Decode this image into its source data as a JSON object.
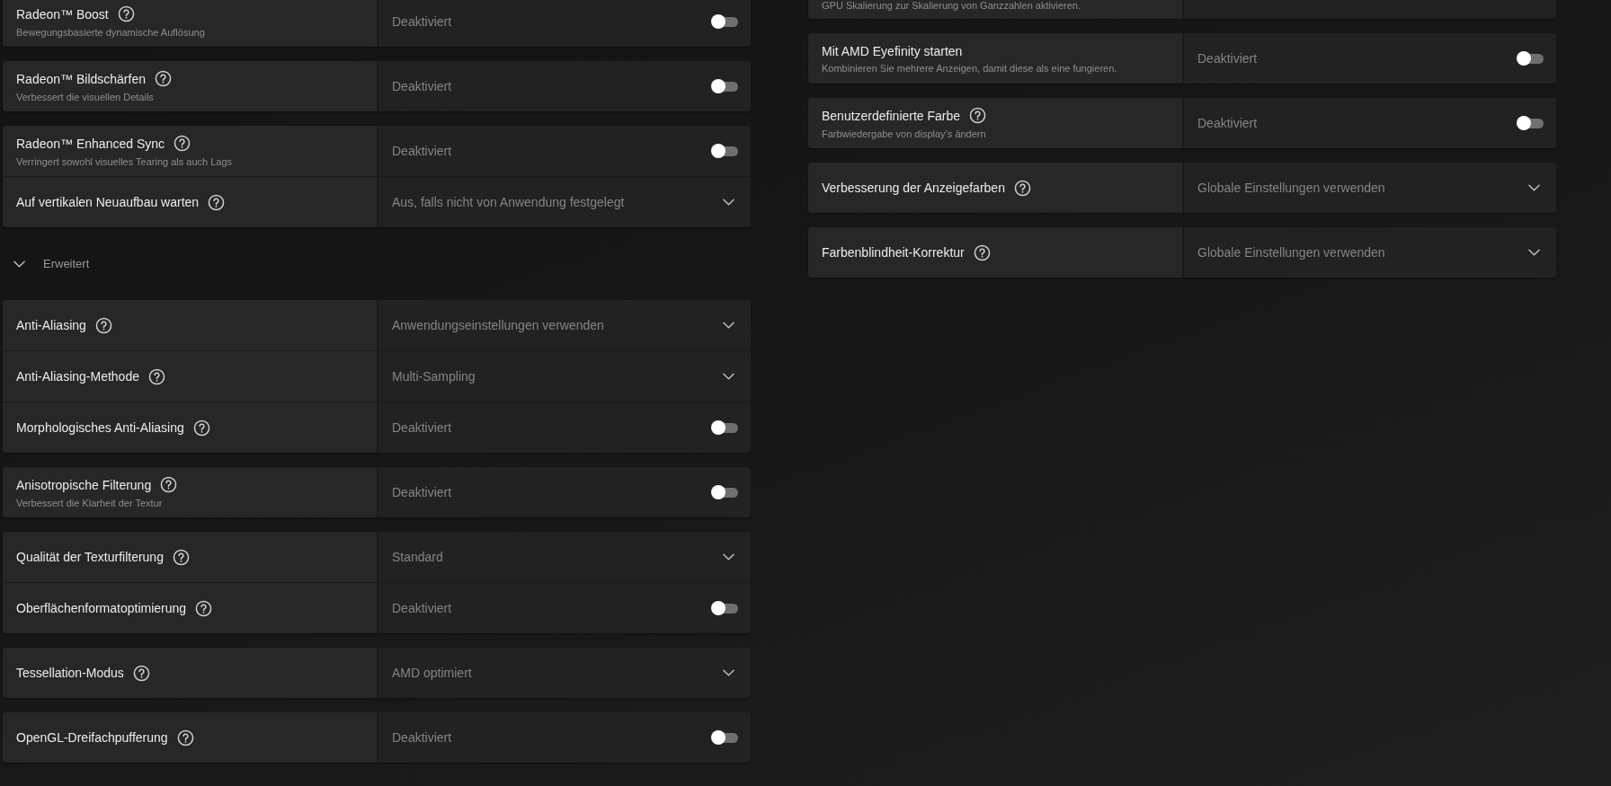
{
  "left_column": {
    "groups": [
      {
        "rows": [
          {
            "title": "Radeon™ Boost",
            "help": true,
            "description": "Bewegungsbasierte dynamische Auflösung",
            "value": "Deaktiviert",
            "kind": "toggle",
            "on": false
          }
        ]
      },
      {
        "rows": [
          {
            "title": "Radeon™ Bildschärfen",
            "help": true,
            "description": "Verbessert die visuellen Details",
            "value": "Deaktiviert",
            "kind": "toggle",
            "on": false
          }
        ]
      },
      {
        "rows": [
          {
            "title": "Radeon™ Enhanced Sync",
            "help": true,
            "description": "Verringert sowohl visuelles Tearing als auch Lags",
            "value": "Deaktiviert",
            "kind": "toggle",
            "on": false
          },
          {
            "title": "Auf vertikalen Neuaufbau warten",
            "help": true,
            "value": "Aus, falls nicht von Anwendung festgelegt",
            "kind": "dropdown"
          }
        ]
      }
    ],
    "advanced": {
      "label": "Erweitert",
      "expanded": true,
      "groups": [
        {
          "rows": [
            {
              "title": "Anti-Aliasing",
              "help": true,
              "value": "Anwendungseinstellungen verwenden",
              "kind": "dropdown"
            },
            {
              "title": "Anti-Aliasing-Methode",
              "help": true,
              "value": "Multi-Sampling",
              "kind": "dropdown"
            },
            {
              "title": "Morphologisches Anti-Aliasing",
              "help": true,
              "value": "Deaktiviert",
              "kind": "toggle",
              "on": false
            }
          ]
        },
        {
          "rows": [
            {
              "title": "Anisotropische Filterung",
              "help": true,
              "description": "Verbessert die Klarheit der Textur",
              "value": "Deaktiviert",
              "kind": "toggle",
              "on": false
            }
          ]
        },
        {
          "rows": [
            {
              "title": "Qualität der Texturfilterung",
              "help": true,
              "value": "Standard",
              "kind": "dropdown"
            },
            {
              "title": "Oberflächenformatoptimierung",
              "help": true,
              "value": "Deaktiviert",
              "kind": "toggle",
              "on": false
            }
          ]
        },
        {
          "rows": [
            {
              "title": "Tessellation-Modus",
              "help": true,
              "value": "AMD optimiert",
              "kind": "dropdown"
            }
          ]
        },
        {
          "rows": [
            {
              "title": "OpenGL-Dreifachpufferung",
              "help": true,
              "value": "Deaktiviert",
              "kind": "toggle",
              "on": false
            }
          ]
        }
      ]
    }
  },
  "right_column": {
    "groups": [
      {
        "rows": [
          {
            "description": "GPU Skalierung zur Skalierung von Ganzzahlen aktivieren.",
            "help": false,
            "kind": "none"
          }
        ]
      },
      {
        "rows": [
          {
            "title": "Mit AMD Eyefinity starten",
            "help": false,
            "description": "Kombinieren Sie mehrere Anzeigen, damit diese als eine fungieren.",
            "value": "Deaktiviert",
            "kind": "toggle",
            "on": false
          }
        ]
      },
      {
        "rows": [
          {
            "title": "Benutzerdefinierte Farbe",
            "help": true,
            "description": "Farbwiedergabe von display’s ändern",
            "value": "Deaktiviert",
            "kind": "toggle",
            "on": false
          }
        ]
      },
      {
        "rows": [
          {
            "title": "Verbesserung der Anzeigefarben",
            "help": true,
            "value": "Globale Einstellungen verwenden",
            "kind": "dropdown"
          }
        ]
      },
      {
        "rows": [
          {
            "title": "Farbenblindheit-Korrektur",
            "help": true,
            "value": "Globale Einstellungen verwenden",
            "kind": "dropdown"
          }
        ]
      }
    ]
  }
}
